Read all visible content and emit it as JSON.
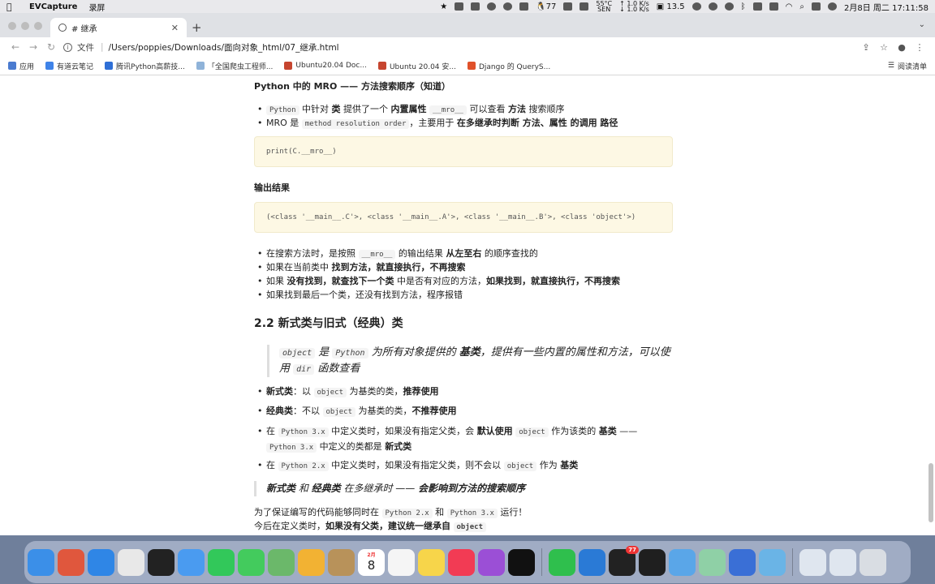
{
  "menubar": {
    "app_name": "EVCapture",
    "menu_record": "录屏",
    "battery_temp": "55°C",
    "battery_sub": "SEN",
    "net_up": "↑ 1.0 K/s",
    "net_down": "↓ 1.0 K/s",
    "qq_badge": "77",
    "memory": "13.5",
    "datetime": "2月8日 周二  17:11:58"
  },
  "browser": {
    "tab_title": "# 继承",
    "address_scheme": "文件",
    "address_path": "/Users/poppies/Downloads/面向对象_html/07_继承.html",
    "bookmarks": [
      {
        "label": "应用",
        "color": "#4a7bd0"
      },
      {
        "label": "有道云笔记",
        "color": "#3f83e8"
      },
      {
        "label": "腾讯Python高薪技...",
        "color": "#2f6fd6"
      },
      {
        "label": "「全国爬虫工程师...",
        "color": "#8fb3d9"
      },
      {
        "label": "Ubuntu20.04 Doc...",
        "color": "#c6452f"
      },
      {
        "label": "Ubuntu 20.04 安...",
        "color": "#c6452f"
      },
      {
        "label": "Django 的 QueryS...",
        "color": "#e0512a"
      }
    ],
    "reading_list": "阅读清单"
  },
  "doc": {
    "mro_heading": "Python 中的 MRO —— 方法搜索顺序（知道）",
    "mro_li1": {
      "code1": "Python",
      "t1": " 中针对 ",
      "b1": "类",
      "t2": " 提供了一个 ",
      "b2": "内置属性",
      "code2": "__mro__",
      "t3": " 可以查看 ",
      "b3": "方法",
      "t4": " 搜索顺序"
    },
    "mro_li2": {
      "t1": "MRO 是 ",
      "code1": "method resolution order",
      "t2": "，主要用于 ",
      "b1": "在多继承时判断 方法、属性 的调用 路径"
    },
    "code1": "print(C.__mro__)",
    "output_heading": "输出结果",
    "code2": "(<class '__main__.C'>, <class '__main__.A'>, <class '__main__.B'>, <class 'object'>)",
    "search_li1": {
      "t1": "在搜索方法时，是按照 ",
      "code1": "__mro__",
      "t2": " 的输出结果 ",
      "b1": "从左至右",
      "t3": " 的顺序查找的"
    },
    "search_li2": {
      "t1": "如果在当前类中 ",
      "b1": "找到方法，就直接执行，不再搜索"
    },
    "search_li3": {
      "t1": "如果 ",
      "b1": "没有找到，就查找下一个类",
      "t2": " 中是否有对应的方法，",
      "b2": "如果找到，就直接执行，不再搜索"
    },
    "search_li4": {
      "t1": "如果找到最后一个类，还没有找到方法，程序报错"
    },
    "section_heading": "2.2 新式类与旧式（经典）类",
    "quote1": {
      "code1": "object",
      "t1": " 是 ",
      "code2": "Python",
      "t2": " 为所有对象提供的 ",
      "b1": "基类",
      "t3": "，提供有一些内置的属性和方法，可以使用 ",
      "code3": "dir",
      "t4": " 函数查看"
    },
    "cls_li1": {
      "b1": "新式类",
      "t1": "：以 ",
      "code1": "object",
      "t2": " 为基类的类，",
      "b2": "推荐使用"
    },
    "cls_li2": {
      "b1": "经典类",
      "t1": "：不以 ",
      "code1": "object",
      "t2": " 为基类的类，",
      "b2": "不推荐使用"
    },
    "cls_li3": {
      "t1": "在 ",
      "code1": "Python 3.x",
      "t2": " 中定义类时，如果没有指定父类，会 ",
      "b1": "默认使用",
      "code2": "object",
      "t3": " 作为该类的 ",
      "b2": "基类",
      "t4": " ——",
      "code3": "Python 3.x",
      "t5": " 中定义的类都是 ",
      "b3": "新式类"
    },
    "cls_li4": {
      "t1": "在 ",
      "code1": "Python 2.x",
      "t2": " 中定义类时，如果没有指定父类，则不会以 ",
      "code2": "object",
      "t3": " 作为 ",
      "b1": "基类"
    },
    "quote2": {
      "b1": "新式类",
      "t1": " 和 ",
      "b2": "经典类",
      "t2": " 在多继承时 —— ",
      "b3": "会影响到方法的搜索顺序"
    },
    "p1": {
      "t1": "为了保证编写的代码能够同时在 ",
      "code1": "Python 2.x",
      "t2": " 和 ",
      "code2": "Python 3.x",
      "t3": " 运行！"
    },
    "p2": {
      "t1": "今后在定义类时，",
      "b1": "如果没有父类，建议统一继承自",
      "code1": "object"
    }
  },
  "dock": {
    "calendar_month": "2月",
    "calendar_day": "8",
    "qq_badge": "77",
    "apps": [
      {
        "name": "finder-icon",
        "color": "#3b8fe8"
      },
      {
        "name": "launchpad-icon",
        "color": "#e0573d"
      },
      {
        "name": "safari-icon",
        "color": "#2f86e6"
      },
      {
        "name": "chrome-icon",
        "color": "#e8e8e8"
      },
      {
        "name": "terminal-icon",
        "color": "#222222"
      },
      {
        "name": "mail-icon",
        "color": "#4a9bf0"
      },
      {
        "name": "facetime-icon",
        "color": "#32c85a"
      },
      {
        "name": "messages-icon",
        "color": "#43cb5d"
      },
      {
        "name": "maps-icon",
        "color": "#6bb86a"
      },
      {
        "name": "photos-icon",
        "color": "#f2b233"
      },
      {
        "name": "keychain-icon",
        "color": "#b8925a"
      },
      {
        "name": "calendar-icon",
        "color": "#ffffff"
      },
      {
        "name": "reminders-icon",
        "color": "#f5f5f5"
      },
      {
        "name": "notes-icon",
        "color": "#f7d54a"
      },
      {
        "name": "music-icon",
        "color": "#f23b54"
      },
      {
        "name": "podcasts-icon",
        "color": "#9b4fd6"
      },
      {
        "name": "appletv-icon",
        "color": "#111111"
      },
      {
        "name": "wechat-icon",
        "color": "#2fbf4d"
      },
      {
        "name": "vscode-icon",
        "color": "#2a7ad6"
      },
      {
        "name": "qq-icon",
        "color": "#222222"
      },
      {
        "name": "pycharm-icon",
        "color": "#1f1f1f"
      },
      {
        "name": "app-icon-1",
        "color": "#5aa6e8"
      },
      {
        "name": "app-icon-2",
        "color": "#8fd0a6"
      },
      {
        "name": "app-icon-3",
        "color": "#3a6fd6"
      },
      {
        "name": "app-icon-4",
        "color": "#6ab4e6"
      },
      {
        "name": "preview-icon",
        "color": "#dfe6ef"
      },
      {
        "name": "preview-icon-2",
        "color": "#dfe6ef"
      },
      {
        "name": "trash-icon",
        "color": "#d9dde3"
      }
    ]
  }
}
